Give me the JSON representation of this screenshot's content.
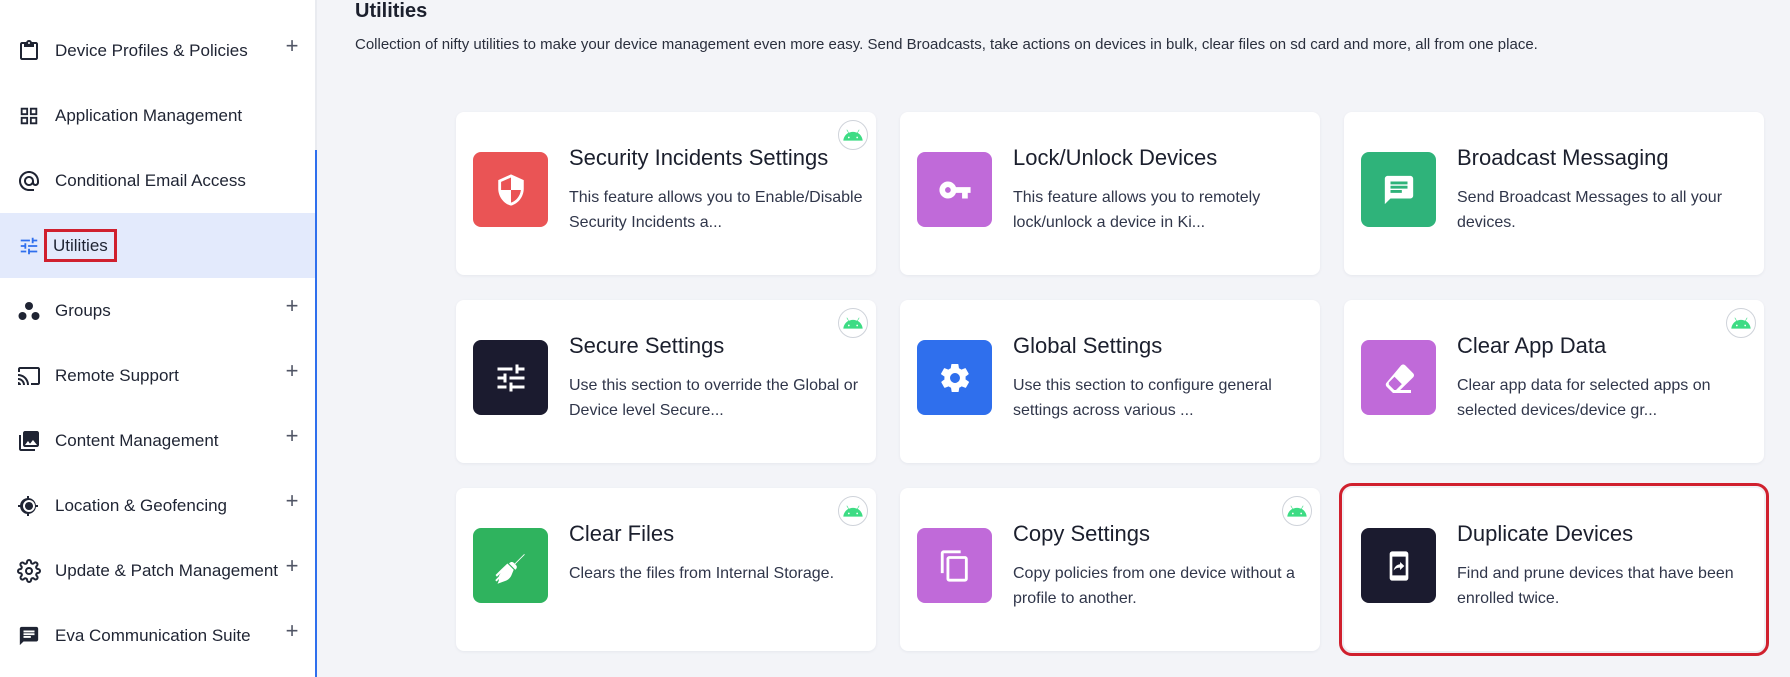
{
  "sidebar": {
    "items": [
      {
        "label": "Device Profiles & Policies",
        "icon": "clipboard-icon",
        "expandable": true
      },
      {
        "label": "Application Management",
        "icon": "grid-icon",
        "expandable": false
      },
      {
        "label": "Conditional Email Access",
        "icon": "at-sign-icon",
        "expandable": false
      },
      {
        "label": "Utilities",
        "icon": "sliders-icon",
        "expandable": false,
        "active": true
      },
      {
        "label": "Groups",
        "icon": "groups-icon",
        "expandable": true
      },
      {
        "label": "Remote Support",
        "icon": "cast-icon",
        "expandable": true
      },
      {
        "label": "Content Management",
        "icon": "images-icon",
        "expandable": true
      },
      {
        "label": "Location & Geofencing",
        "icon": "location-icon",
        "expandable": true
      },
      {
        "label": "Update & Patch Management",
        "icon": "gear-icon",
        "expandable": true
      },
      {
        "label": "Eva Communication Suite",
        "icon": "chat-icon",
        "expandable": true
      }
    ],
    "expand_symbol": "+"
  },
  "main": {
    "title": "Utilities",
    "description": "Collection of nifty utilities to make your device management even more easy. Send Broadcasts, take actions on devices in bulk, clear files on sd card and more, all from one place.",
    "cards": [
      {
        "title": "Security Incidents Settings",
        "desc": "This feature allows you to Enable/Disable Security Incidents a...",
        "icon": "shield-icon",
        "color": "#ea5455",
        "android": true
      },
      {
        "title": "Lock/Unlock Devices",
        "desc": "This feature allows you to remotely lock/unlock a device in Ki...",
        "icon": "key-icon",
        "color": "#c06ad9",
        "android": false
      },
      {
        "title": "Broadcast Messaging",
        "desc": "Send Broadcast Messages to all your devices.",
        "icon": "message-icon",
        "color": "#2fb37a",
        "android": false
      },
      {
        "title": "Secure Settings",
        "desc": "Use this section to override the Global or Device level Secure...",
        "icon": "tune-icon",
        "color": "#1b1b2f",
        "android": true
      },
      {
        "title": "Global Settings",
        "desc": "Use this section to configure general settings across various ...",
        "icon": "gear-icon",
        "color": "#2f6fed",
        "android": false
      },
      {
        "title": "Clear App Data",
        "desc": "Clear app data for selected apps on selected devices/device gr...",
        "icon": "eraser-icon",
        "color": "#c06ad9",
        "android": true
      },
      {
        "title": "Clear Files",
        "desc": "Clears the files from Internal Storage.",
        "icon": "broom-icon",
        "color": "#2fb35e",
        "android": true
      },
      {
        "title": "Copy Settings",
        "desc": "Copy policies from one device without a profile to another.",
        "icon": "copy-icon",
        "color": "#c06ad9",
        "android": true
      },
      {
        "title": "Duplicate Devices",
        "desc": "Find and prune devices that have been enrolled twice.",
        "icon": "phone-share-icon",
        "color": "#1b1b2f",
        "android": false,
        "selected": true
      }
    ]
  },
  "colors": {
    "accent": "#2f6fed",
    "highlight": "#d0202e",
    "android": "#3ddc84"
  }
}
